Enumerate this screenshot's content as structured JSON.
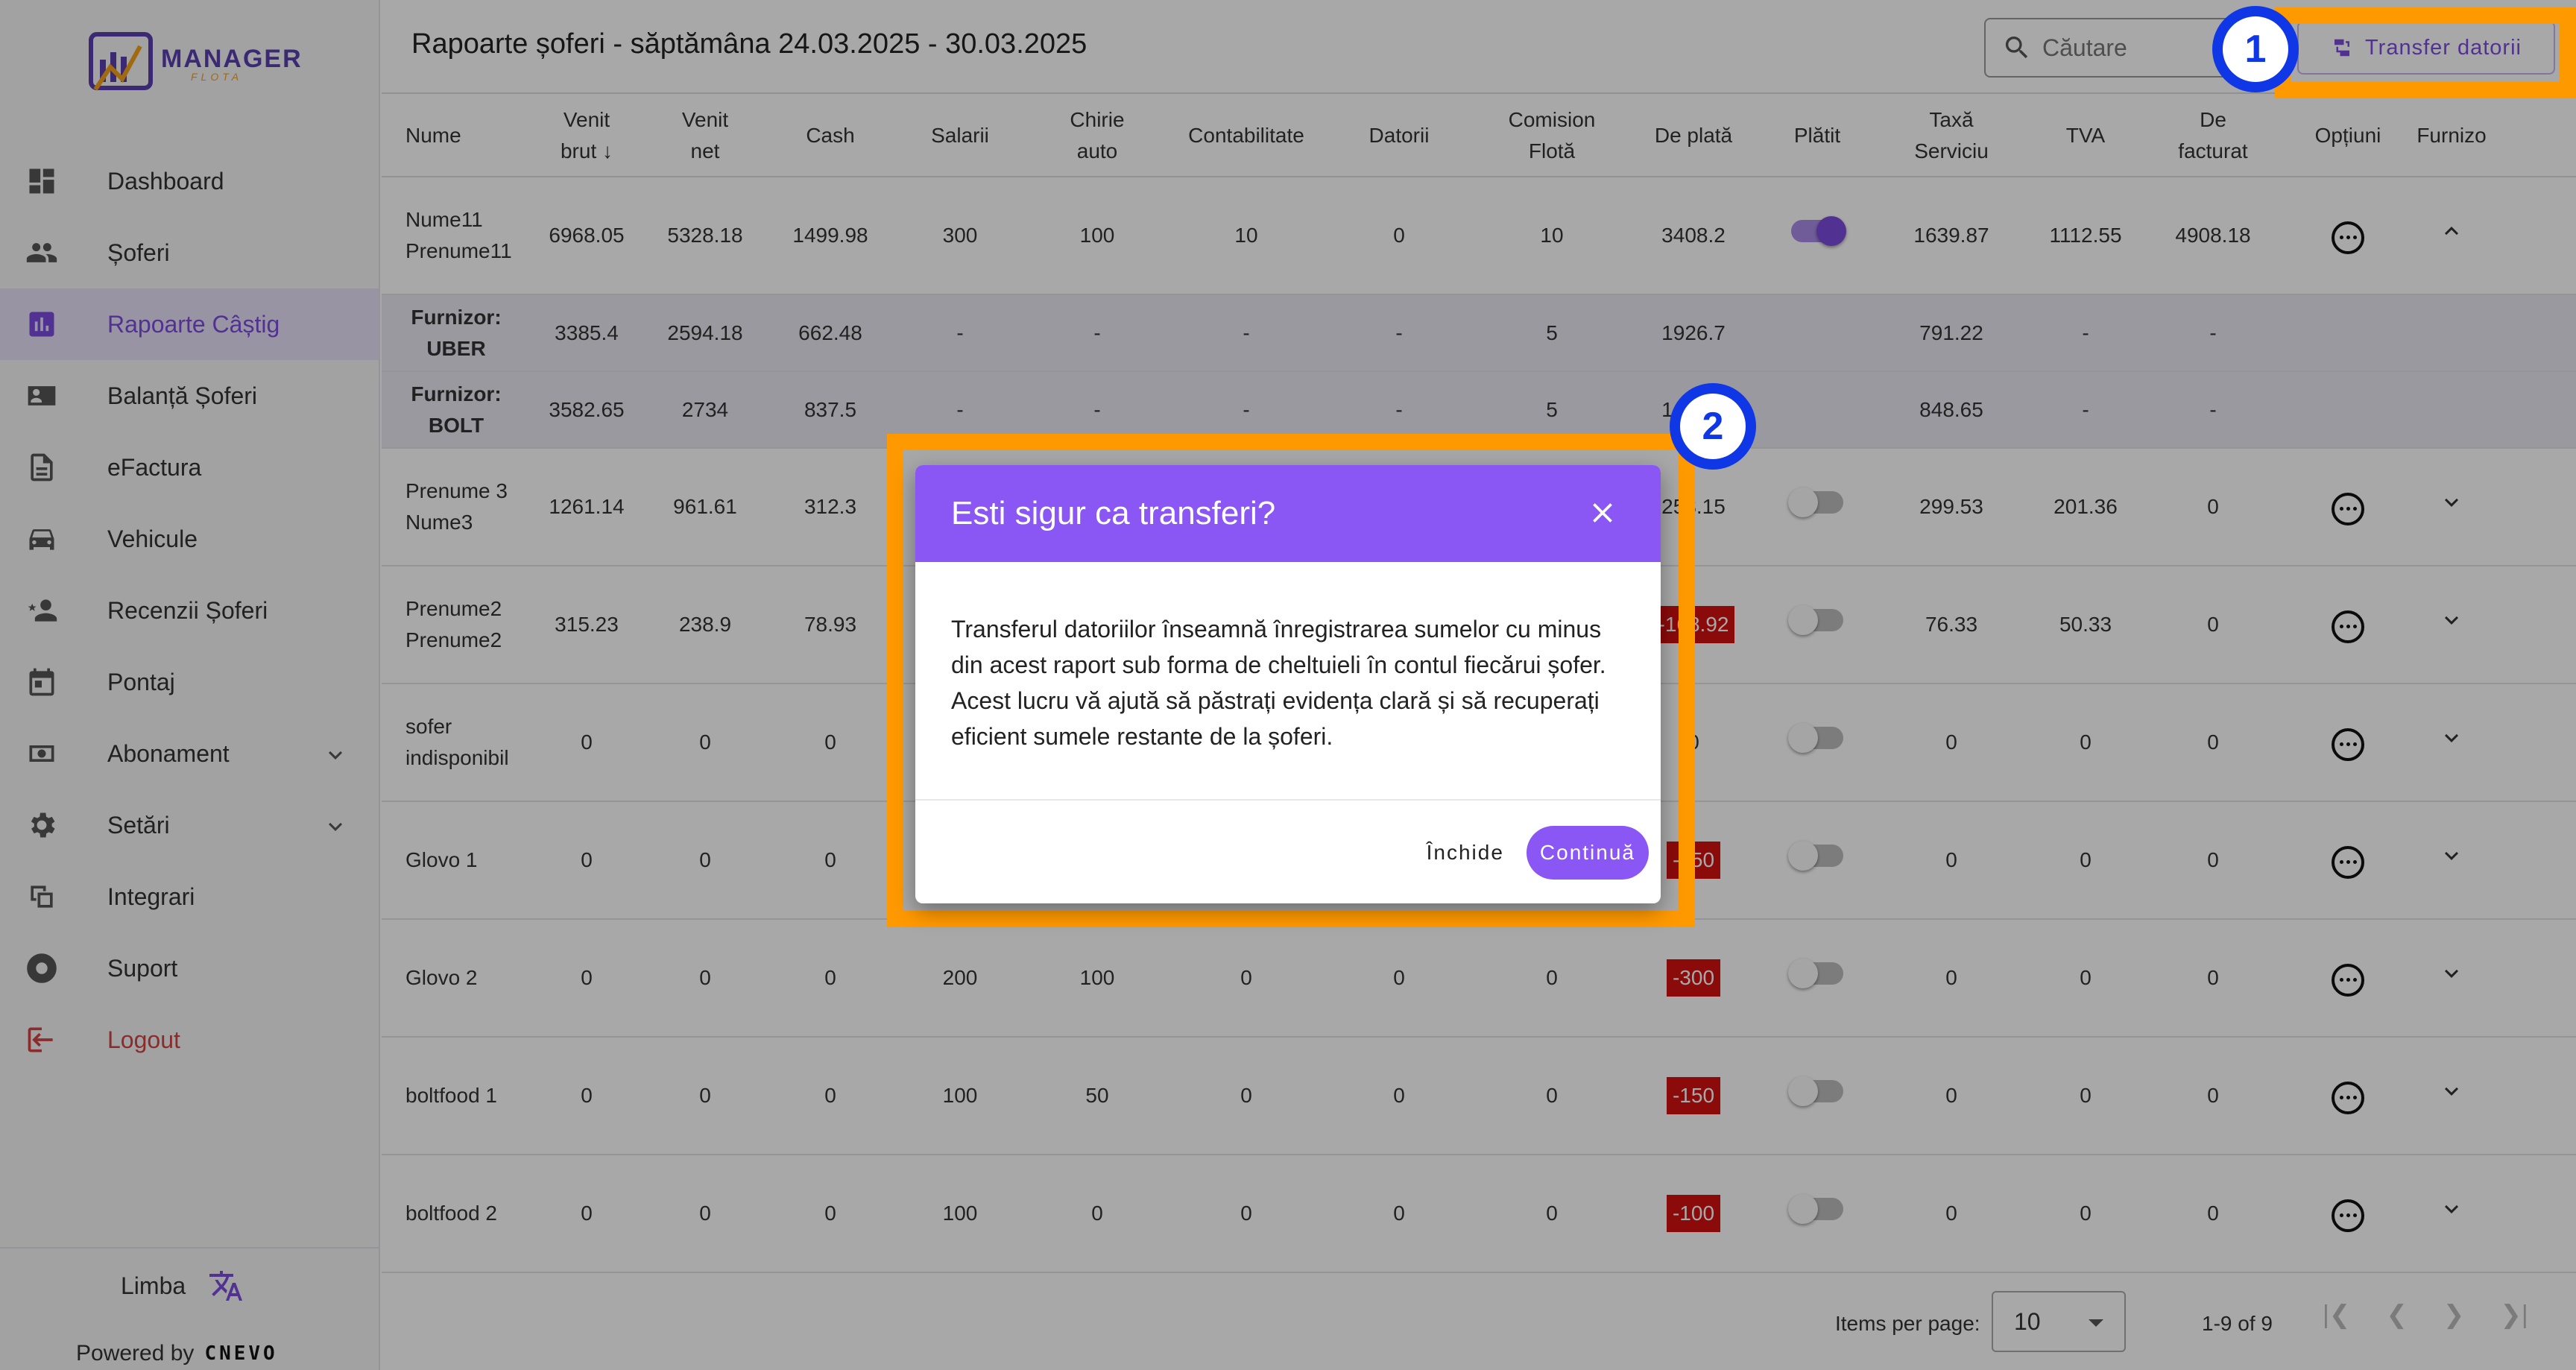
{
  "brand": {
    "name": "MANAGER",
    "sub": "FLOTA"
  },
  "nav": [
    {
      "label": "Dashboard",
      "icon": "dashboard-icon"
    },
    {
      "label": "Șoferi",
      "icon": "people-icon"
    },
    {
      "label": "Rapoarte Câștig",
      "icon": "report-icon",
      "active": true
    },
    {
      "label": "Balanță Șoferi",
      "icon": "id-card-icon"
    },
    {
      "label": "eFactura",
      "icon": "document-icon"
    },
    {
      "label": "Vehicule",
      "icon": "car-icon"
    },
    {
      "label": "Recenzii Șoferi",
      "icon": "review-icon"
    },
    {
      "label": "Pontaj",
      "icon": "calendar-icon"
    },
    {
      "label": "Abonament",
      "icon": "subscription-icon",
      "expandable": true
    },
    {
      "label": "Setări",
      "icon": "gear-icon",
      "expandable": true
    },
    {
      "label": "Integrari",
      "icon": "integration-icon"
    },
    {
      "label": "Suport",
      "icon": "support-icon"
    },
    {
      "label": "Logout",
      "icon": "logout-icon"
    }
  ],
  "language_label": "Limba",
  "powered_by": {
    "label": "Powered by",
    "brand": "CNEVO"
  },
  "page_title": "Rapoarte șoferi - săptămâna 24.03.2025 - 30.03.2025",
  "search_placeholder": "Căutare",
  "transfer_button": "Transfer datorii",
  "columns": [
    "Nume",
    "Venit brut",
    "Venit net",
    "Cash",
    "Salarii",
    "Chirie auto",
    "Contabilitate",
    "Datorii",
    "Comision Flotă",
    "De plată",
    "Plătit",
    "Taxă Serviciu",
    "TVA",
    "De facturat",
    "Opțiuni",
    "Furnizo"
  ],
  "rows": [
    {
      "type": "main",
      "name": "Nume11 Prenume11",
      "cells": [
        "6968.05",
        "5328.18",
        "1499.98",
        "300",
        "100",
        "10",
        "0",
        "10",
        "3408.2"
      ],
      "de_plata_negative": false,
      "paid": true,
      "tail": [
        "1639.87",
        "1112.55",
        "4908.18"
      ],
      "expanded": true
    },
    {
      "type": "sub",
      "name": "Furnizor: UBER",
      "cells": [
        "3385.4",
        "2594.18",
        "662.48",
        "-",
        "-",
        "-",
        "-",
        "5",
        "1926.7"
      ],
      "tail": [
        "791.22",
        "-",
        "-"
      ]
    },
    {
      "type": "sub",
      "name": "Furnizor: BOLT",
      "cells": [
        "3582.65",
        "2734",
        "837.5",
        "-",
        "-",
        "-",
        "-",
        "5",
        "1481.5"
      ],
      "tail": [
        "848.65",
        "-",
        "-"
      ]
    },
    {
      "type": "main",
      "name": "Prenume 3 Nume3",
      "cells": [
        "1261.14",
        "961.61",
        "312.3",
        "",
        "",
        "",
        "",
        "",
        "253.15"
      ],
      "de_plata_negative": false,
      "paid": false,
      "tail": [
        "299.53",
        "201.36",
        "0"
      ]
    },
    {
      "type": "main",
      "name": "Prenume2 Prenume2",
      "cells": [
        "315.23",
        "238.9",
        "78.93",
        "",
        "",
        "",
        "",
        "",
        "-168.92"
      ],
      "de_plata_negative": true,
      "paid": false,
      "tail": [
        "76.33",
        "50.33",
        "0"
      ]
    },
    {
      "type": "main",
      "name": "sofer indisponibil",
      "cells": [
        "0",
        "0",
        "0",
        "",
        "",
        "",
        "",
        "",
        "0"
      ],
      "de_plata_negative": false,
      "paid": false,
      "tail": [
        "0",
        "0",
        "0"
      ]
    },
    {
      "type": "main",
      "name": "Glovo 1",
      "cells": [
        "0",
        "0",
        "0",
        "",
        "",
        "",
        "",
        "",
        "-150"
      ],
      "de_plata_negative": true,
      "paid": false,
      "tail": [
        "0",
        "0",
        "0"
      ]
    },
    {
      "type": "main",
      "name": "Glovo 2",
      "cells": [
        "0",
        "0",
        "0",
        "200",
        "100",
        "0",
        "0",
        "0",
        "-300"
      ],
      "de_plata_negative": true,
      "paid": false,
      "tail": [
        "0",
        "0",
        "0"
      ]
    },
    {
      "type": "main",
      "name": "boltfood 1",
      "cells": [
        "0",
        "0",
        "0",
        "100",
        "50",
        "0",
        "0",
        "0",
        "-150"
      ],
      "de_plata_negative": true,
      "paid": false,
      "tail": [
        "0",
        "0",
        "0"
      ]
    },
    {
      "type": "main",
      "name": "boltfood 2",
      "cells": [
        "0",
        "0",
        "0",
        "100",
        "0",
        "0",
        "0",
        "0",
        "-100"
      ],
      "de_plata_negative": true,
      "paid": false,
      "tail": [
        "0",
        "0",
        "0"
      ]
    }
  ],
  "pagination": {
    "label": "Items per page:",
    "per_page": "10",
    "range": "1-9 of 9"
  },
  "dialog": {
    "title": "Esti sigur ca transferi?",
    "body": "Transferul datoriilor înseamnă înregistrarea sumelor cu minus din acest raport sub forma de cheltuieli în contul fiecărui șofer. Acest lucru vă ajută să păstrați evidența clară și să recuperați eficient sumele restante de la șoferi.",
    "cancel": "Închide",
    "confirm": "Continuă"
  },
  "step_badges": [
    "1",
    "2"
  ],
  "colors": {
    "accent": "#7b4de0",
    "dialog_header": "#8a57f5",
    "highlight": "#ff9900",
    "badge": "#1037e6",
    "negative": "#d41010"
  }
}
